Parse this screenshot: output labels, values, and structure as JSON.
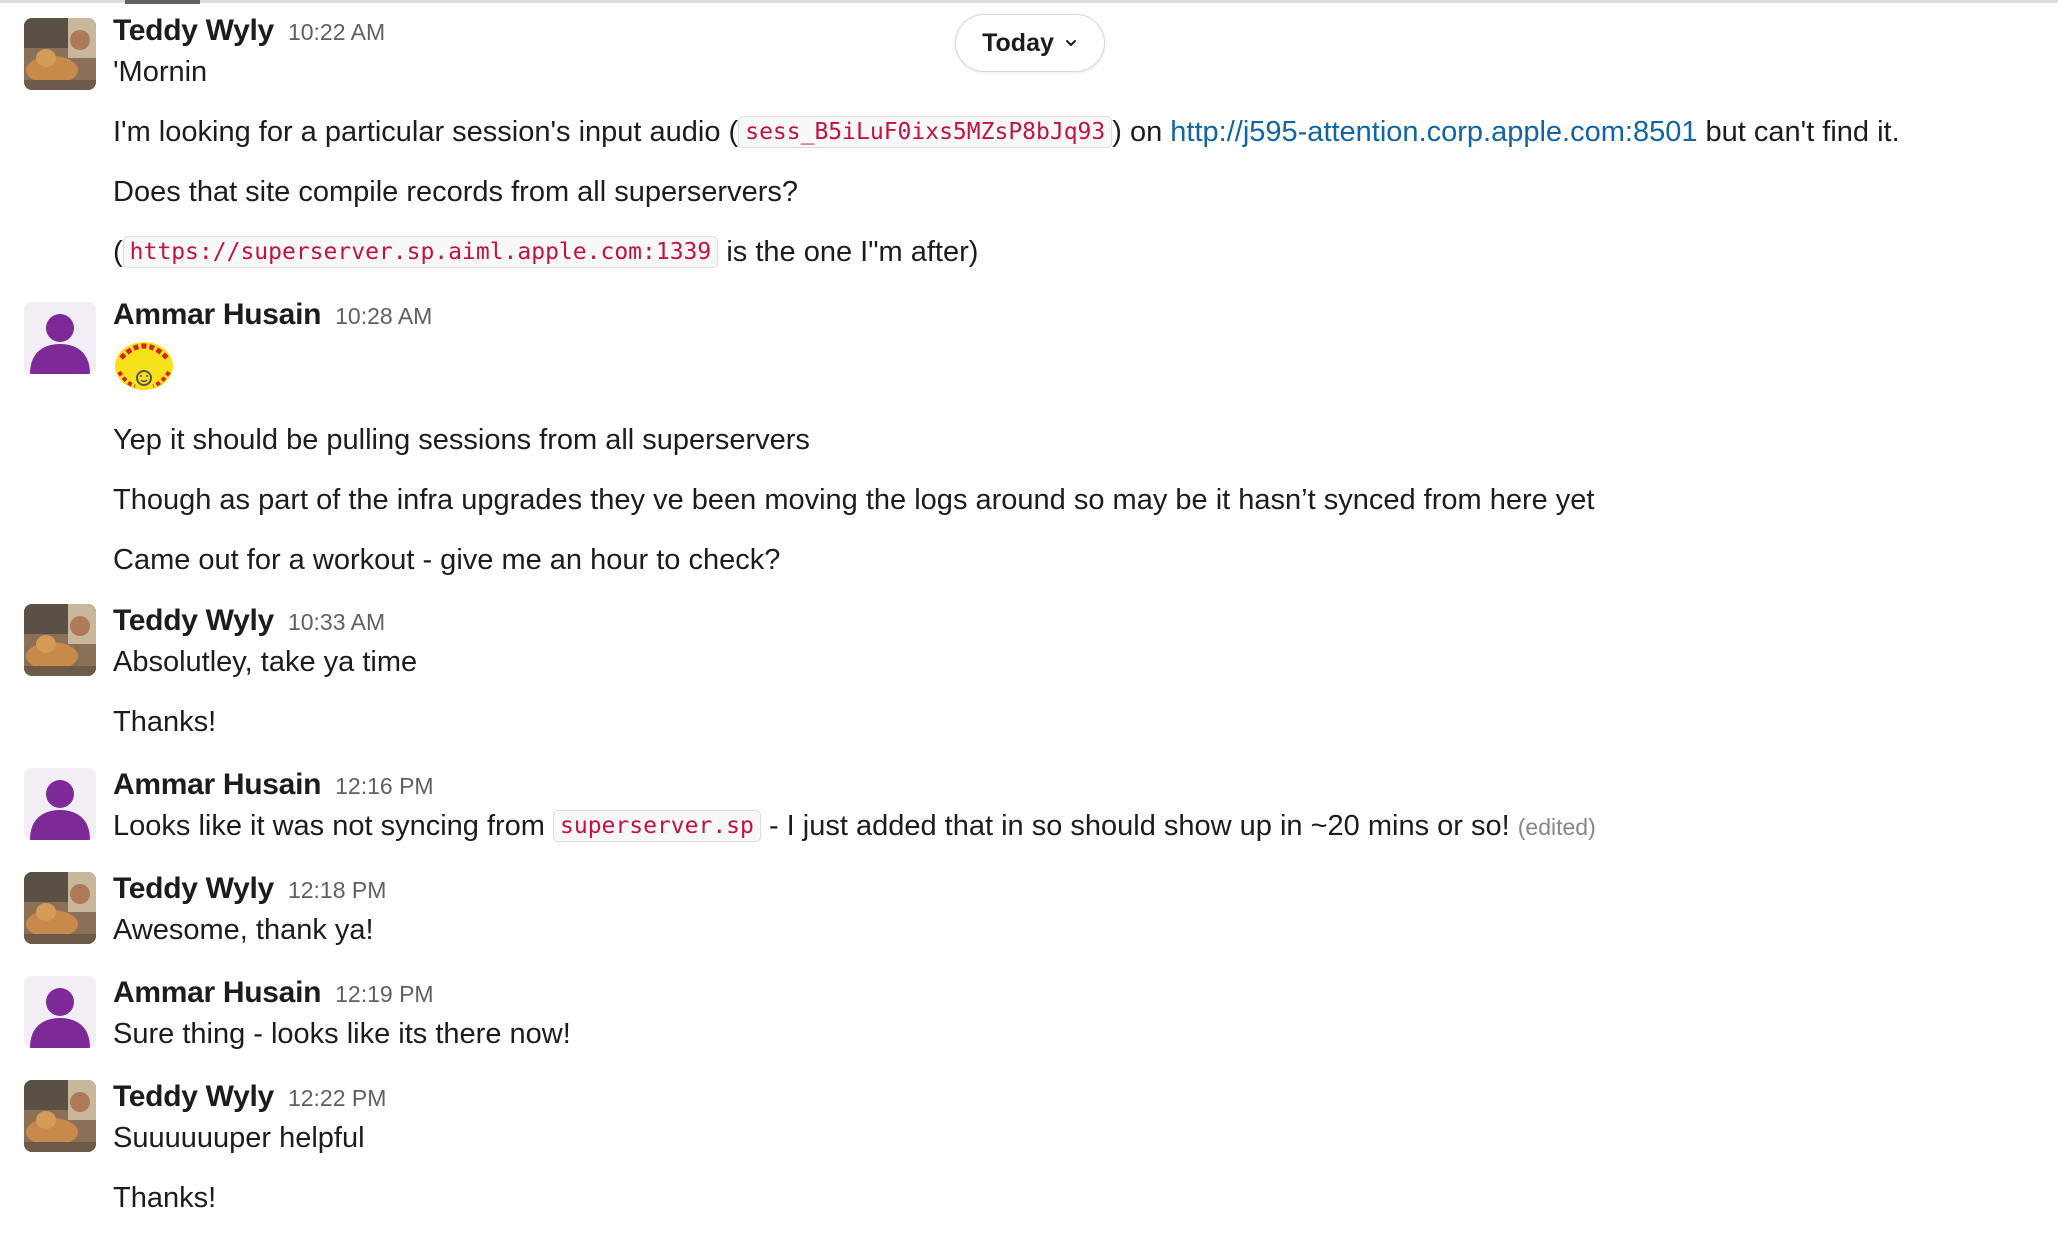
{
  "date_divider": {
    "label": "Today"
  },
  "messages": [
    {
      "sender": "Teddy Wyly",
      "time": "10:22 AM",
      "lines": {
        "l1": "'Mornin",
        "l2": {
          "before": "I'm looking for a particular session's input audio (",
          "code": "sess_B5iLuF0ixs5MZsP8bJq93",
          "middle": ") on ",
          "link": "http://j595-attention.corp.apple.com:8501",
          "after": " but can't find it."
        },
        "l3": "Does that site compile records from all superservers?",
        "l4": {
          "before": "(",
          "code": "https://superserver.sp.aiml.apple.com:1339",
          "after": " is the one I\"m after)"
        }
      }
    },
    {
      "sender": "Ammar Husain",
      "time": "10:28 AM",
      "emoji": "good-morning-emoji",
      "lines": {
        "l1": "Yep it should be pulling sessions from all superservers",
        "l2": "Though as part of the infra upgrades they ve been moving the logs around so may be it hasn’t synced from here yet",
        "l3": "Came out for a workout - give me an hour to check?"
      }
    },
    {
      "sender": "Teddy Wyly",
      "time": "10:33 AM",
      "lines": {
        "l1": "Absolutley, take ya time",
        "l2": "Thanks!"
      }
    },
    {
      "sender": "Ammar Husain",
      "time": "12:16 PM",
      "lines": {
        "l1": {
          "before": "Looks like it was not syncing from ",
          "code": "superserver.sp",
          "after": " - I just added that in so should show up in ~20 mins or so! ",
          "edited": "(edited)"
        }
      }
    },
    {
      "sender": "Teddy Wyly",
      "time": "12:18 PM",
      "lines": {
        "l1": "Awesome, thank ya!"
      }
    },
    {
      "sender": "Ammar Husain",
      "time": "12:19 PM",
      "lines": {
        "l1": "Sure thing - looks like its there now!"
      }
    },
    {
      "sender": "Teddy Wyly",
      "time": "12:22 PM",
      "lines": {
        "l1": "Suuuuuuper helpful",
        "l2": "Thanks!"
      }
    }
  ],
  "colors": {
    "link": "#1264a3",
    "code_text": "#c01343",
    "avatar_purple": "#7d2a98"
  }
}
